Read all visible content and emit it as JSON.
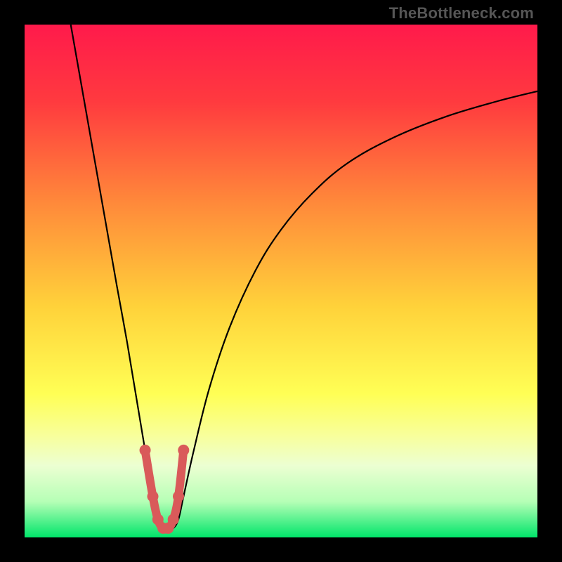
{
  "watermark": "TheBottleneck.com",
  "chart_data": {
    "type": "line",
    "title": "",
    "xlabel": "",
    "ylabel": "",
    "xlim": [
      0,
      100
    ],
    "ylim": [
      0,
      100
    ],
    "background_gradient": {
      "stops": [
        {
          "offset": 0.0,
          "color": "#ff1a4b"
        },
        {
          "offset": 0.15,
          "color": "#ff3a3f"
        },
        {
          "offset": 0.35,
          "color": "#ff8a3a"
        },
        {
          "offset": 0.55,
          "color": "#ffd23a"
        },
        {
          "offset": 0.72,
          "color": "#ffff55"
        },
        {
          "offset": 0.8,
          "color": "#f8ff9a"
        },
        {
          "offset": 0.86,
          "color": "#ecffd2"
        },
        {
          "offset": 0.93,
          "color": "#b6ffb6"
        },
        {
          "offset": 1.0,
          "color": "#00e56a"
        }
      ]
    },
    "series": [
      {
        "name": "bottleneck-curve",
        "color": "#000000",
        "x": [
          9.0,
          12.0,
          15.0,
          18.0,
          20.0,
          22.0,
          23.5,
          25.0,
          26.0,
          27.0,
          28.0,
          29.0,
          30.0,
          31.0,
          33.0,
          36.0,
          40.0,
          45.0,
          50.0,
          56.0,
          63.0,
          72.0,
          82.0,
          92.0,
          100.0
        ],
        "values": [
          100.0,
          83.0,
          66.0,
          49.0,
          38.0,
          26.0,
          17.0,
          8.0,
          3.5,
          1.8,
          1.5,
          1.8,
          3.5,
          8.0,
          17.0,
          29.0,
          41.0,
          52.0,
          60.0,
          67.0,
          73.0,
          78.0,
          82.0,
          85.0,
          87.0
        ]
      }
    ],
    "valley_marker": {
      "color": "#d95a5a",
      "x": [
        23.5,
        25.0,
        26.0,
        27.0,
        28.0,
        29.0,
        30.0,
        31.0
      ],
      "values": [
        17.0,
        8.0,
        3.5,
        1.8,
        1.8,
        3.5,
        8.0,
        17.0
      ]
    }
  }
}
